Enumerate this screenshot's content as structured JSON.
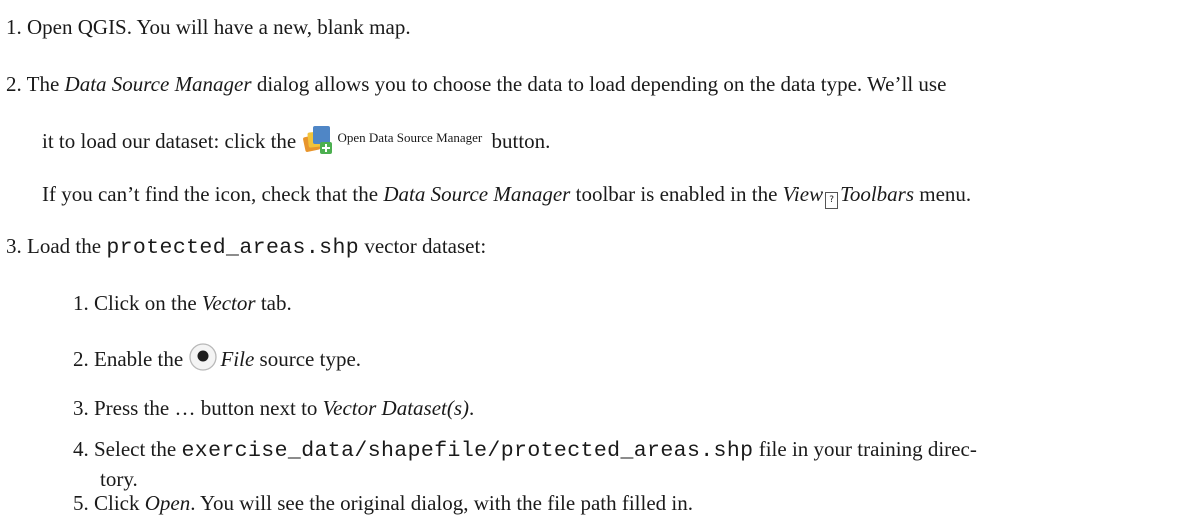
{
  "steps": [
    {
      "num": "1.",
      "text": "Open QGIS. You will have a new, blank map."
    },
    {
      "num": "2.",
      "intro_pre": "The ",
      "intro_em": "Data Source Manager",
      "intro_post": " dialog allows you to choose the data to load depending on the data type. We’ll use",
      "line2_pre": "it to load our dataset: click the ",
      "button_label": "Open Data Source Manager",
      "line2_post": " button.",
      "note_pre": "If you can’t find the icon, check that the ",
      "note_em": "Data Source Manager",
      "note_mid": " toolbar is enabled in the ",
      "note_em2": "View",
      "note_glyph": "?",
      "note_em3": "Toolbars",
      "note_post": " menu."
    },
    {
      "num": "3.",
      "pre": "Load the ",
      "code": "protected_areas.shp",
      "post": " vector dataset:"
    }
  ],
  "substeps": [
    {
      "num": "1.",
      "pre": "Click on the ",
      "em": "Vector",
      "post": " tab."
    },
    {
      "num": "2.",
      "pre": "Enable the ",
      "em": "File",
      "post": " source type."
    },
    {
      "num": "3.",
      "pre": "Press the … button next to ",
      "em": "Vector Dataset(s)",
      "post": "."
    },
    {
      "num": "4.",
      "pre": "Select the ",
      "code": "exercise_data/shapefile/protected_areas.shp",
      "post": " file in your training direc-",
      "cont": "tory."
    },
    {
      "num": "5.",
      "pre": "Click ",
      "em": "Open",
      "post": ". You will see the original dialog, with the file path filled in."
    }
  ],
  "icons": {
    "data_source_manager": "data-source-manager-icon",
    "radio": "radio-button-selected-icon"
  }
}
